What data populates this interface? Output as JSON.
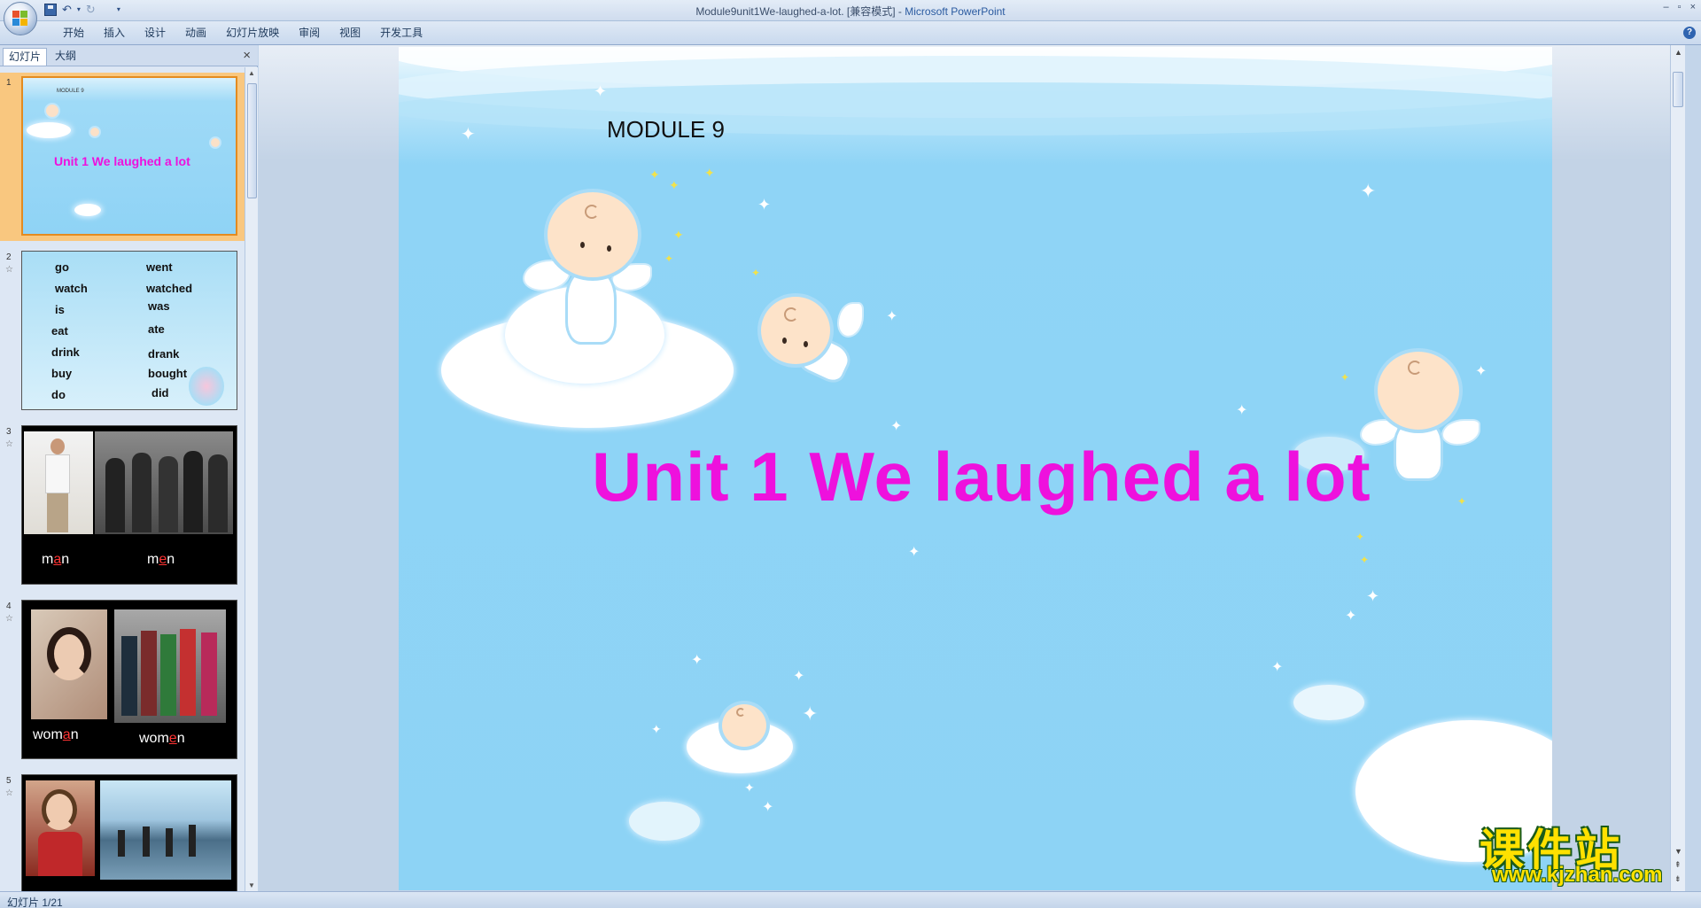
{
  "window": {
    "title": "Module9unit1We-laughed-a-lot. [兼容模式]",
    "separator": " - ",
    "app": "Microsoft PowerPoint",
    "controls": [
      "–",
      "▫",
      "×"
    ]
  },
  "ribbon": {
    "tabs": [
      "开始",
      "插入",
      "设计",
      "动画",
      "幻灯片放映",
      "审阅",
      "视图",
      "开发工具"
    ],
    "help": "?"
  },
  "left_panel": {
    "tabs": [
      "幻灯片",
      "大纲"
    ],
    "close": "×",
    "thumbnails": [
      {
        "number": "1",
        "module": "MODULE 9",
        "title": "Unit 1 We laughed a lot"
      },
      {
        "number": "2",
        "words_left": [
          "go",
          "watch",
          "is",
          "eat",
          "drink",
          "buy",
          "do"
        ],
        "words_right": [
          "went",
          "watched",
          "was",
          "ate",
          "drank",
          "bought",
          "did"
        ]
      },
      {
        "number": "3",
        "caption_left": {
          "pre": "m",
          "hl": "a",
          "post": "n"
        },
        "caption_right": {
          "pre": "m",
          "hl": "e",
          "post": "n"
        }
      },
      {
        "number": "4",
        "caption_left": {
          "pre": "wom",
          "hl": "a",
          "post": "n"
        },
        "caption_right": {
          "pre": "wom",
          "hl": "e",
          "post": "n"
        }
      },
      {
        "number": "5"
      }
    ]
  },
  "slide": {
    "module": "MODULE 9",
    "title": "Unit 1 We laughed a lot",
    "title_color": "#ee11dd"
  },
  "watermark": {
    "cn": "课件站",
    "url": "www.kjzhan.com"
  },
  "status": {
    "text": "幻灯片 1/21"
  }
}
